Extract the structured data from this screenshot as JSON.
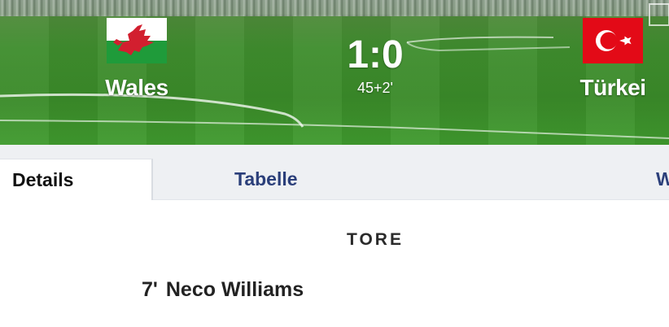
{
  "match": {
    "home": {
      "name": "Wales",
      "flag_icon": "wales-flag-icon"
    },
    "away": {
      "name": "Türkei",
      "flag_icon": "turkey-flag-icon"
    },
    "score": "1:0",
    "minute": "45+2'"
  },
  "tabs": [
    {
      "label": "Details",
      "active": true
    },
    {
      "label": "Tabelle",
      "active": false
    },
    {
      "label": "W",
      "active": false
    }
  ],
  "goals_section": {
    "title": "TORE",
    "goals": [
      {
        "minute": "7'",
        "player": "Neco Williams"
      }
    ]
  },
  "colors": {
    "pitch_green": "#3a8a29",
    "tab_bar_bg": "#eef0f3",
    "tab_link": "#2b3f7a",
    "wales_green": "#1f9b3a",
    "wales_red": "#d21f2f",
    "turkey_red": "#e30a17"
  }
}
